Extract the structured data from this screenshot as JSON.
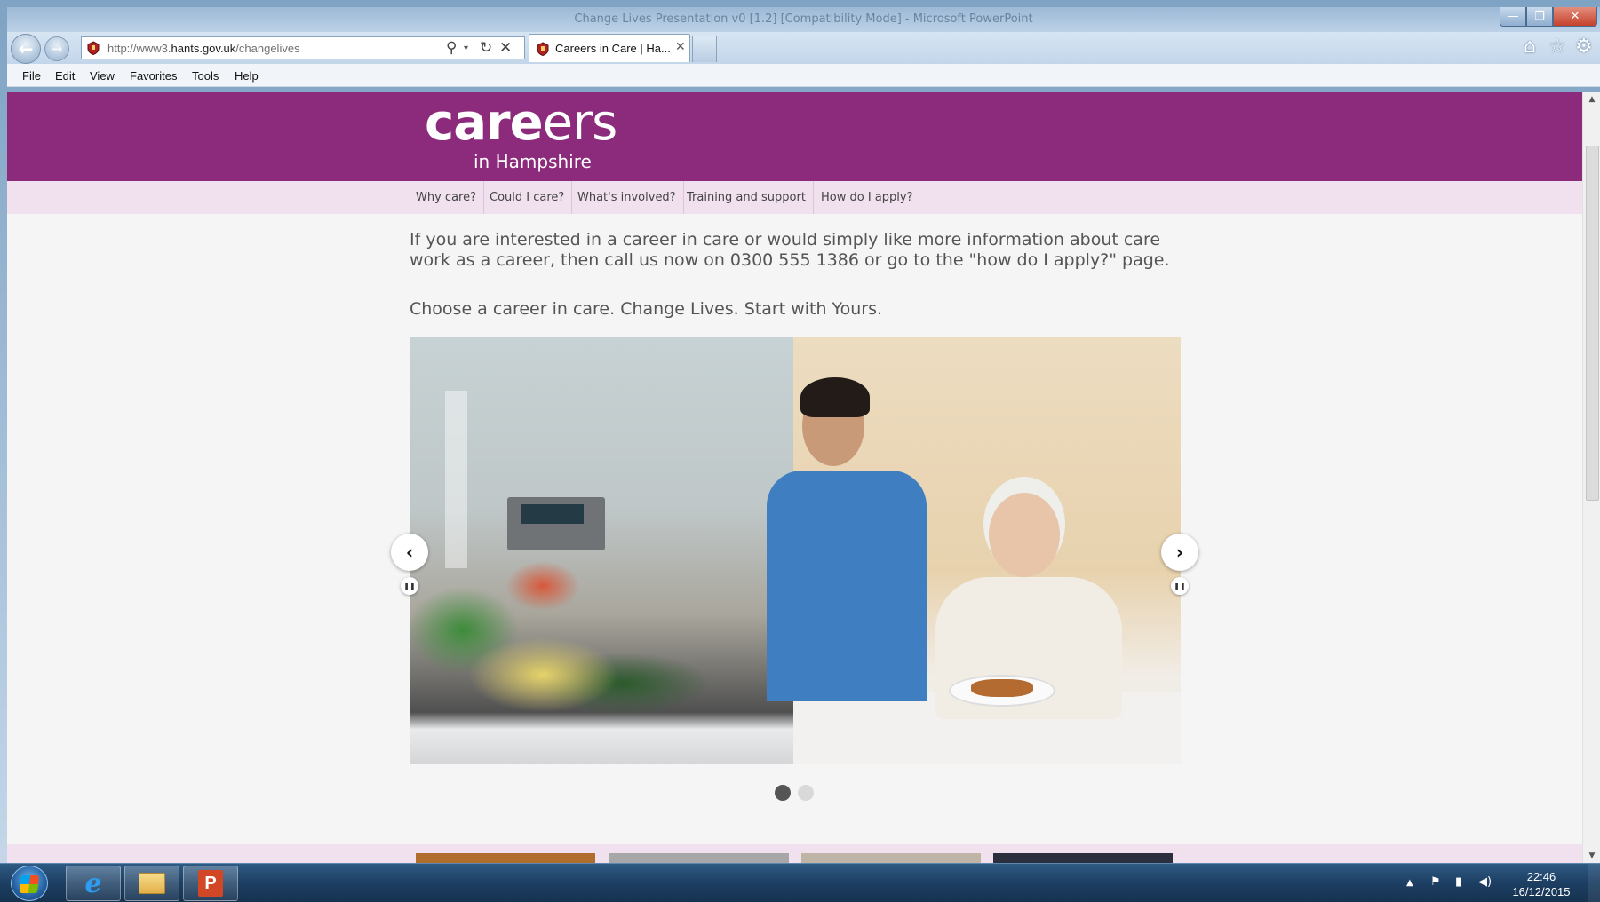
{
  "browser": {
    "window_title": "Change Lives Presentation v0 [1.2] [Compatibility Mode] - Microsoft PowerPoint",
    "window_controls": {
      "minimize": "—",
      "maximize": "❐",
      "close": "✕"
    },
    "nav": {
      "back": "←",
      "forward": "→"
    },
    "address": {
      "prefix": "http://www3.",
      "host": "hants.gov.uk",
      "path": "/changelives"
    },
    "address_icons": {
      "search": "⚲",
      "dropdown": "▾",
      "refresh": "↻",
      "stop": "✕"
    },
    "tab": {
      "label": "Careers in Care | Ha...",
      "close": "✕"
    },
    "toolbar_icons": {
      "home": "⌂",
      "favorites": "☆",
      "settings": "⚙"
    },
    "menu": {
      "file": "File",
      "edit": "Edit",
      "view": "View",
      "favorites": "Favorites",
      "tools": "Tools",
      "help": "Help"
    }
  },
  "page": {
    "logo": {
      "main_bold": "care",
      "main_light": "ers",
      "sub": "in Hampshire"
    },
    "nav": {
      "why": "Why care?",
      "could": "Could I care?",
      "involved": "What's involved?",
      "training": "Training and support",
      "apply": "How do I apply?"
    },
    "intro": "If you are interested in a career in care or would simply like more information about care work as a career, then call us now on 0300 555 1386 or go to the \"how do I apply?\" page.",
    "tagline": "Choose a career in care. Change Lives. Start with Yours.",
    "carousel": {
      "prev": "‹",
      "next": "›",
      "pause": "❚❚",
      "slide_count": 2,
      "active_slide": 1
    },
    "scrollbar": {
      "up": "▲",
      "down": "▼"
    }
  },
  "taskbar": {
    "ie_glyph": "e",
    "powerpoint_glyph": "P",
    "tray": {
      "expand": "▲",
      "flag": "⚑",
      "network": "▮",
      "volume": "◀)"
    },
    "clock": {
      "time": "22:46",
      "date": "16/12/2015"
    }
  },
  "colors": {
    "brand_purple": "#8c2a7b",
    "nav_pink": "#f1e1ee",
    "page_bg": "#f5f5f5"
  }
}
